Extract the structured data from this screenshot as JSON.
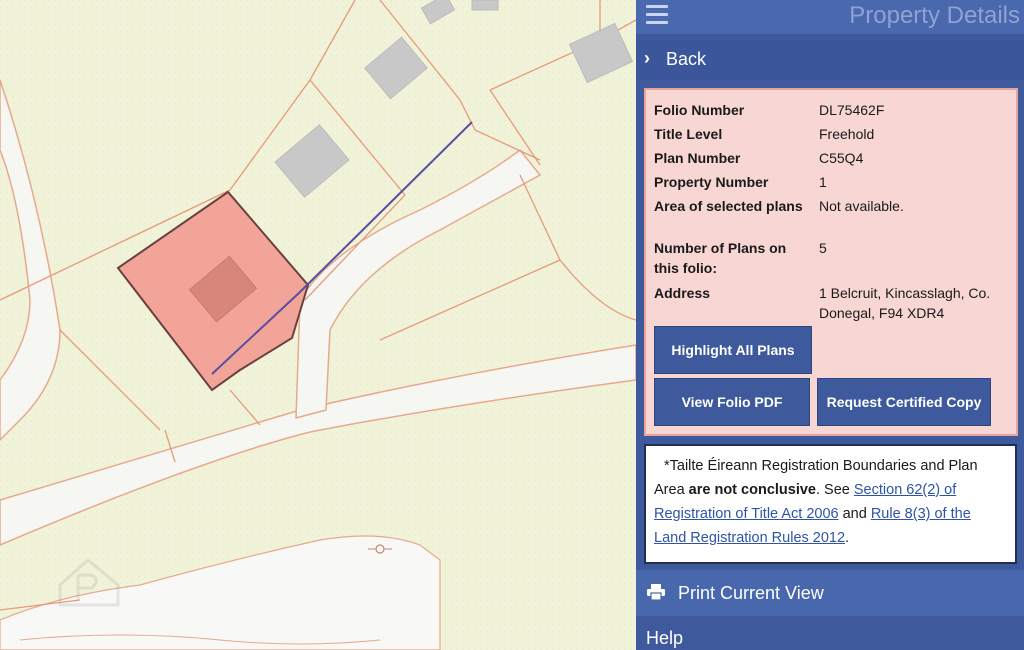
{
  "header": {
    "title": "Property Details",
    "menu_icon": "hamburger-menu-icon"
  },
  "back": {
    "label": "Back",
    "icon": "chevron-right-icon"
  },
  "details": {
    "rows": [
      {
        "label": "Folio Number",
        "value": "DL75462F"
      },
      {
        "label": "Title Level",
        "value": "Freehold"
      },
      {
        "label": "Plan Number",
        "value": "C55Q4"
      },
      {
        "label": "Property Number",
        "value": "1"
      },
      {
        "label": "Area of selected plans",
        "value": "Not available."
      },
      {
        "label": "Number of Plans on this folio:",
        "value": "5"
      },
      {
        "label": "Address",
        "value": "1 Belcruit, Kincasslagh, Co. Donegal, F94 XDR4"
      }
    ],
    "buttons": {
      "highlight": "Highlight All Plans",
      "view_pdf": "View Folio PDF",
      "request_copy": "Request Certified Copy"
    }
  },
  "notice": {
    "text_1": "*Tailte Éireann Registration Boundaries and Plan Area ",
    "bold": "are not conclusive",
    "text_2": ". See ",
    "link_1": "Section 62(2) of Registration of Title Act 2006",
    "text_3": " and ",
    "link_2": "Rule 8(3) of the Land Registration Rules 2012",
    "text_4": "."
  },
  "print": {
    "label": "Print Current View",
    "icon": "printer-icon"
  },
  "help": {
    "label": "Help"
  },
  "colors": {
    "panel": "#3e5a9c",
    "details_bg": "#f7d6d3",
    "selected_plot": "#f1a497",
    "map_bg": "#f1f3d9",
    "boundary": "#e7997a"
  }
}
